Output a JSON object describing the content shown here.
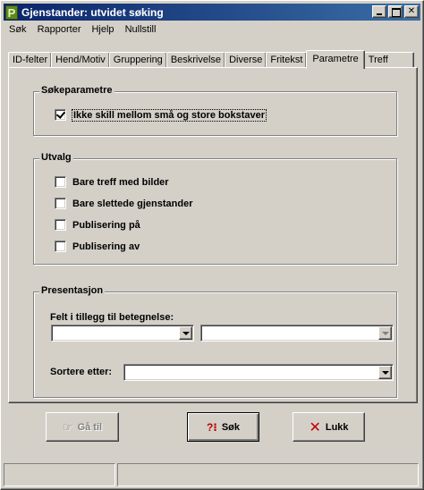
{
  "window": {
    "title": "Gjenstander: utvidet søking",
    "app_icon_letter": "P"
  },
  "menu": {
    "items": [
      "Søk",
      "Rapporter",
      "Hjelp",
      "Nullstill"
    ]
  },
  "tabs": {
    "items": [
      "ID-felter",
      "Hend/Motiv",
      "Gruppering",
      "Beskrivelse",
      "Diverse",
      "Fritekst",
      "Parametre",
      "Treff"
    ],
    "active": "Parametre"
  },
  "sokeparametre": {
    "title": "Søkeparametre",
    "case_insensitive_label": "Ikke skill mellom små og store bokstaver",
    "case_insensitive_checked": true
  },
  "utvalg": {
    "title": "Utvalg",
    "options": [
      {
        "label": "Bare treff med bilder",
        "checked": false
      },
      {
        "label": "Bare slettede gjenstander",
        "checked": false
      },
      {
        "label": "Publisering på",
        "checked": false
      },
      {
        "label": "Publisering av",
        "checked": false
      }
    ]
  },
  "presentasjon": {
    "title": "Presentasjon",
    "extra_field_label": "Felt i tillegg til betegnelse:",
    "extra_field_1_value": "",
    "extra_field_2_value": "",
    "sort_label": "Sortere etter:",
    "sort_value": ""
  },
  "buttons": {
    "goto_label": "Gå til",
    "search_label": "Søk",
    "search_icon_text": "?⁝",
    "close_label": "Lukk"
  },
  "status": {
    "panel1": "",
    "panel2": ""
  }
}
